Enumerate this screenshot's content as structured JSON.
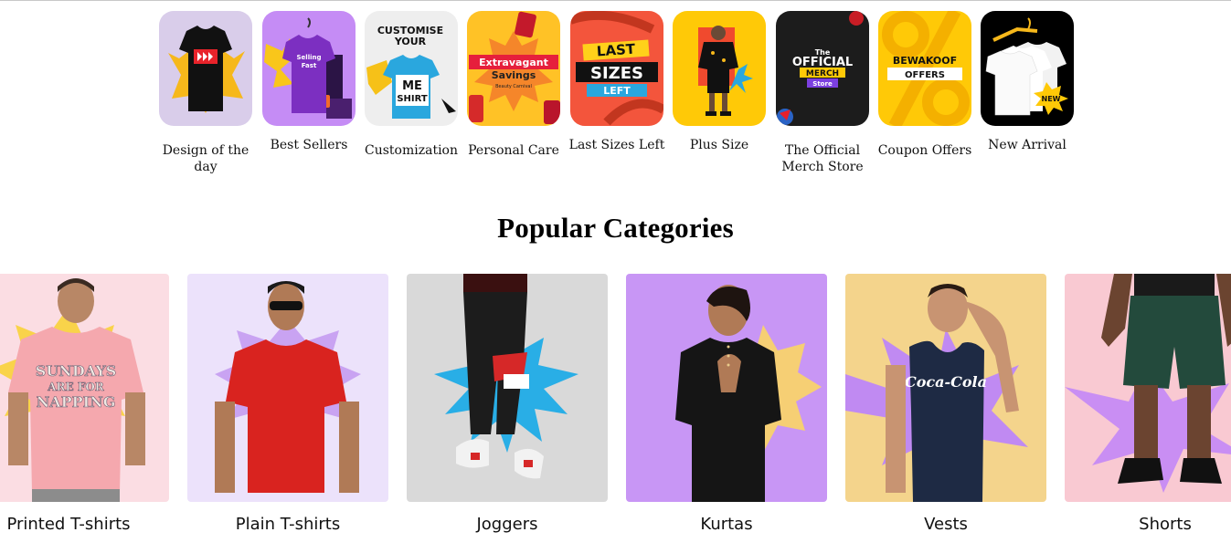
{
  "stories": [
    {
      "label": "Design of the day",
      "bg": "#d9cdea",
      "art_icon": "tshirt-icon"
    },
    {
      "label": "Best Sellers",
      "bg": "#c58cf5",
      "art_icon": "tshirt-icon",
      "art_text": "Selling Fast"
    },
    {
      "label": "Customization",
      "bg": "#eeeeee",
      "art_icon": "tshirt-icon",
      "art_text": [
        "CUSTOMISE",
        "YOUR",
        "ME",
        "SHIRT"
      ]
    },
    {
      "label": "Personal Care",
      "bg": "#ffc226",
      "art_icon": "tag-icon",
      "art_text": [
        "Extravagant",
        "Savings",
        "Beauty Carnival"
      ]
    },
    {
      "label": "Last Sizes Left",
      "bg": "#f3553c",
      "art_icon": "tag-icon",
      "art_text": [
        "LAST",
        "SIZES",
        "LEFT"
      ]
    },
    {
      "label": "Plus Size",
      "bg": "#ffc907",
      "art_icon": "person-icon"
    },
    {
      "label": "The Official Merch Store",
      "bg": "#1c1c1c",
      "art_icon": "badge-icon",
      "art_text": [
        "The",
        "OFFICIAL",
        "MERCH",
        "Store"
      ]
    },
    {
      "label": "Coupon Offers",
      "bg": "#ffc907",
      "art_icon": "percent-icon",
      "art_text": [
        "BEWAKOOF",
        "OFFERS"
      ]
    },
    {
      "label": "New Arrival",
      "bg": "#000000",
      "art_icon": "tshirt-icon",
      "art_text": "NEW"
    }
  ],
  "popular": {
    "title": "Popular Categories",
    "items": [
      {
        "label": "Printed T-shirts",
        "bg": "#fbdde3",
        "burst": "#f9d34a",
        "garment": "#f5a8ae",
        "print_text": [
          "SUNDAYS",
          "ARE FOR",
          "NAPPING"
        ]
      },
      {
        "label": "Plain T-shirts",
        "bg": "#ece2fb",
        "burst": "#c9a3f2",
        "garment": "#d9231f"
      },
      {
        "label": "Joggers",
        "bg": "#d9d9d9",
        "burst": "#29aee6",
        "garment": "#1c1c1c"
      },
      {
        "label": "Kurtas",
        "bg": "#c896f5",
        "burst": "#f6cf74",
        "garment": "#151515"
      },
      {
        "label": "Vests",
        "bg": "#f4d48c",
        "burst": "#c08af2",
        "garment": "#1e2a44",
        "print_text": [
          "Coca-Cola"
        ]
      },
      {
        "label": "Shorts",
        "bg": "#f9c9d2",
        "burst": "#c98ef3",
        "garment": "#234a3c"
      }
    ]
  }
}
